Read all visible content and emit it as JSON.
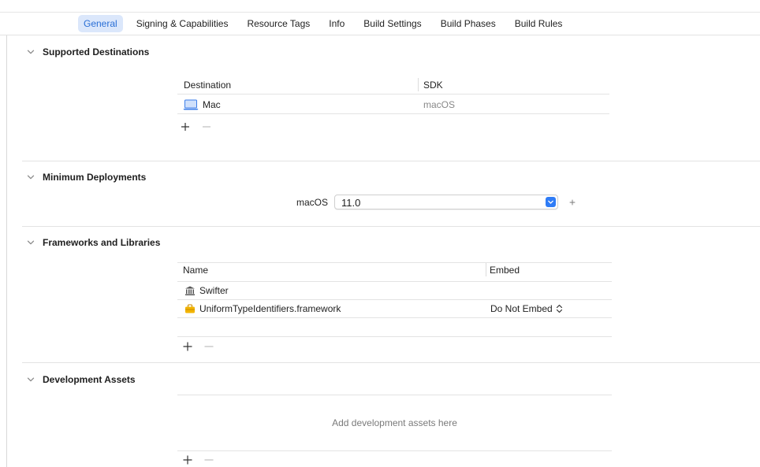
{
  "tabs": [
    {
      "label": "General",
      "active": true
    },
    {
      "label": "Signing & Capabilities",
      "active": false
    },
    {
      "label": "Resource Tags",
      "active": false
    },
    {
      "label": "Info",
      "active": false
    },
    {
      "label": "Build Settings",
      "active": false
    },
    {
      "label": "Build Phases",
      "active": false
    },
    {
      "label": "Build Rules",
      "active": false
    }
  ],
  "supported_destinations": {
    "title": "Supported Destinations",
    "col_destination": "Destination",
    "col_sdk": "SDK",
    "rows": [
      {
        "destination": "Mac",
        "sdk": "macOS",
        "icon": "laptop-icon"
      }
    ]
  },
  "minimum_deployments": {
    "title": "Minimum Deployments",
    "platform_label": "macOS",
    "version": "11.0"
  },
  "frameworks": {
    "title": "Frameworks and Libraries",
    "col_name": "Name",
    "col_embed": "Embed",
    "rows": [
      {
        "name": "Swifter",
        "embed": "",
        "icon": "library-icon"
      },
      {
        "name": "UniformTypeIdentifiers.framework",
        "embed": "Do Not Embed",
        "icon": "framework-toolbox-icon"
      }
    ]
  },
  "development_assets": {
    "title": "Development Assets",
    "empty_message": "Add development assets here"
  },
  "colors": {
    "accent": "#2f7cf6",
    "tab_active_bg": "#dbe7fb",
    "tab_active_text": "#2a6fd6",
    "framework_icon": "#f2b400"
  }
}
